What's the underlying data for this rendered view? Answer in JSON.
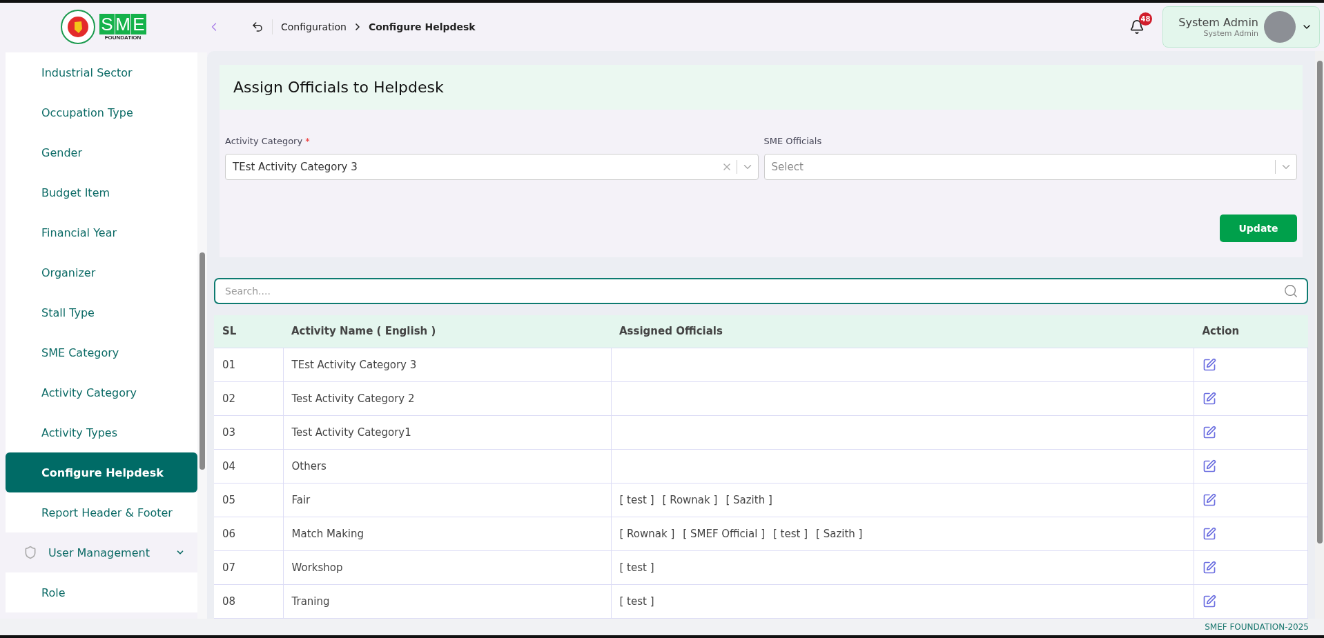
{
  "logo": {
    "letters": [
      "S",
      "M",
      "E"
    ],
    "subtitle": "FOUNDATION"
  },
  "header": {
    "breadcrumb": [
      {
        "label": "Configuration",
        "current": false
      },
      {
        "label": "Configure Helpdesk",
        "current": true
      }
    ],
    "notifications": "48",
    "user": {
      "name": "System Admin",
      "role": "System Admin"
    }
  },
  "sidebar": {
    "items": [
      {
        "kind": "link",
        "label": "Industrial Sector",
        "selected": false
      },
      {
        "kind": "link",
        "label": "Occupation Type",
        "selected": false
      },
      {
        "kind": "link",
        "label": "Gender",
        "selected": false
      },
      {
        "kind": "link",
        "label": "Budget Item",
        "selected": false
      },
      {
        "kind": "link",
        "label": "Financial Year",
        "selected": false
      },
      {
        "kind": "link",
        "label": "Organizer",
        "selected": false
      },
      {
        "kind": "link",
        "label": "Stall Type",
        "selected": false
      },
      {
        "kind": "link",
        "label": "SME Category",
        "selected": false
      },
      {
        "kind": "link",
        "label": "Activity Category",
        "selected": false
      },
      {
        "kind": "link",
        "label": "Activity Types",
        "selected": false
      },
      {
        "kind": "link",
        "label": "Configure Helpdesk",
        "selected": true
      },
      {
        "kind": "link",
        "label": "Report Header & Footer",
        "selected": false
      },
      {
        "kind": "group",
        "label": "User Management",
        "expanded": true,
        "children": [
          {
            "label": "Role",
            "selected": false
          }
        ]
      }
    ]
  },
  "page": {
    "title": "Assign Officials to Helpdesk",
    "form": {
      "required_mark": "*",
      "fields": [
        {
          "label": "Activity Category",
          "required": true,
          "value": "TEst Activity Category 3"
        },
        {
          "label": "SME Officials",
          "required": false,
          "placeholder": "Select"
        }
      ],
      "button": "Update"
    },
    "search": {
      "placeholder": "Search...."
    },
    "table": {
      "columns": [
        "SL",
        "Activity Name ( English )",
        "Assigned Officials",
        "Action"
      ],
      "rows": [
        {
          "sl": "01",
          "name": "TEst Activity Category 3",
          "officials": []
        },
        {
          "sl": "02",
          "name": "Test Activity Category 2",
          "officials": []
        },
        {
          "sl": "03",
          "name": "Test Activity Category1",
          "officials": []
        },
        {
          "sl": "04",
          "name": "Others",
          "officials": []
        },
        {
          "sl": "05",
          "name": "Fair",
          "officials": [
            "[ test ]",
            "[ Rownak ]",
            "[ Sazith ]"
          ]
        },
        {
          "sl": "06",
          "name": "Match Making",
          "officials": [
            "[ Rownak ]",
            "[ SMEF Official ]",
            "[ test ]",
            "[ Sazith ]"
          ]
        },
        {
          "sl": "07",
          "name": "Workshop",
          "officials": [
            "[ test ]"
          ]
        },
        {
          "sl": "08",
          "name": "Traning",
          "officials": [
            "[ test ]"
          ]
        }
      ]
    }
  },
  "footer": "SMEF FOUNDATION-2025"
}
